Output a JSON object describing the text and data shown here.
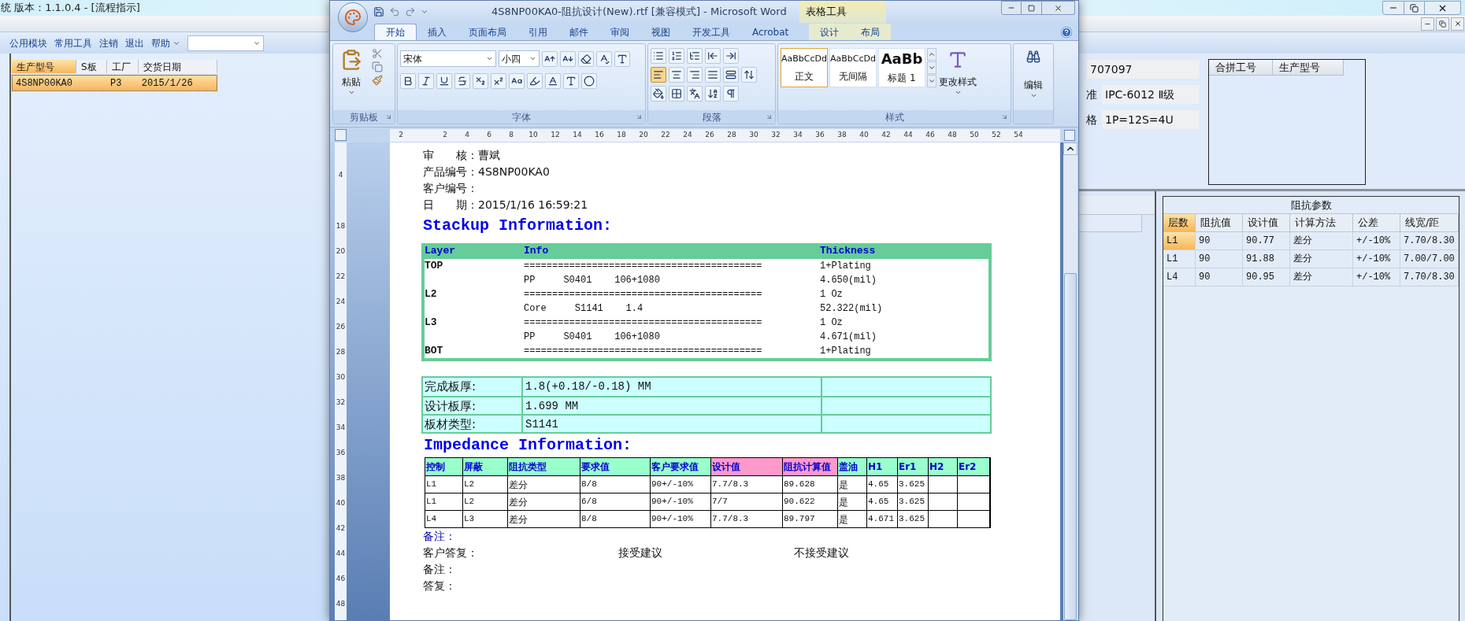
{
  "app": {
    "title": "统 版本：1.1.0.4 - [流程指示]",
    "menu": [
      {
        "label": "公用模块",
        "dropdown": false
      },
      {
        "label": "常用工具",
        "dropdown": false
      },
      {
        "label": "注销",
        "dropdown": false
      },
      {
        "label": "退出",
        "dropdown": false
      },
      {
        "label": "帮助",
        "dropdown": true
      }
    ],
    "grid": {
      "columns": [
        "生产型号",
        "S板",
        "工厂",
        "交货日期"
      ],
      "rows": [
        {
          "cells": [
            "4S8NP00KA0",
            null,
            "P3",
            "2015/1/26"
          ],
          "selected": true
        }
      ]
    },
    "fields": [
      {
        "value": "707097"
      },
      {
        "label": "准",
        "value": "IPC-6012 Ⅱ级"
      },
      {
        "label": "格",
        "value": "1P=12S=4U"
      }
    ],
    "merge_grid": {
      "columns": [
        "合拼工号",
        "生产型号"
      ]
    },
    "impedance": {
      "title": "阻抗参数",
      "columns": [
        "层数",
        "阻抗值",
        "设计值",
        "计算方法",
        "公差",
        "线宽/距"
      ],
      "rows": [
        {
          "cells": [
            "L1",
            "90",
            "90.77",
            "差分",
            "+/-10%",
            "7.70/8.30"
          ],
          "selected": true
        },
        {
          "cells": [
            "L1",
            "90",
            "91.88",
            "差分",
            "+/-10%",
            "7.00/7.00"
          ],
          "selected": false
        },
        {
          "cells": [
            "L4",
            "90",
            "90.95",
            "差分",
            "+/-10%",
            "7.70/8.30"
          ],
          "selected": false
        }
      ]
    }
  },
  "word": {
    "title": "4S8NP00KA0-阻抗设计(New).rtf [兼容模式] - Microsoft Word",
    "contextual_title": "表格工具",
    "tabs": [
      {
        "label": "开始",
        "selected": true,
        "kind": "normal"
      },
      {
        "label": "插入",
        "selected": false,
        "kind": "normal"
      },
      {
        "label": "页面布局",
        "selected": false,
        "kind": "normal"
      },
      {
        "label": "引用",
        "selected": false,
        "kind": "normal"
      },
      {
        "label": "邮件",
        "selected": false,
        "kind": "normal"
      },
      {
        "label": "审阅",
        "selected": false,
        "kind": "normal"
      },
      {
        "label": "视图",
        "selected": false,
        "kind": "normal"
      },
      {
        "label": "开发工具",
        "selected": false,
        "kind": "normal"
      },
      {
        "label": "Acrobat",
        "selected": false,
        "kind": "normal"
      },
      {
        "label": "设计",
        "selected": false,
        "kind": "contextual"
      },
      {
        "label": "布局",
        "selected": false,
        "kind": "contextual"
      }
    ],
    "ribbon": {
      "paste_label": "粘贴",
      "font": "宋体",
      "size": "小四",
      "alignment": [
        {
          "kind": "left",
          "selected": true
        },
        {
          "kind": "center",
          "selected": false
        },
        {
          "kind": "right",
          "selected": false
        },
        {
          "kind": "justify",
          "selected": false
        },
        {
          "kind": "distributed",
          "selected": false
        }
      ],
      "styles": [
        {
          "preview": "AaBbCcDd",
          "name": "正文",
          "selected": true,
          "kind": "body"
        },
        {
          "preview": "AaBbCcDd",
          "name": "无间隔",
          "selected": false,
          "kind": "body"
        },
        {
          "preview": "AaBb",
          "name": "标题 1",
          "selected": false,
          "kind": "heading"
        }
      ],
      "change_styles_label": "更改样式",
      "edit_label": "编辑",
      "groups": [
        "剪贴板",
        "字体",
        "段落",
        "样式"
      ]
    },
    "ruler": {
      "horizontal": [
        "2",
        "2",
        "4",
        "6",
        "8",
        "10",
        "12",
        "14",
        "16",
        "18",
        "20",
        "22",
        "24",
        "26",
        "28",
        "30",
        "32",
        "34",
        "36",
        "38",
        "40",
        "42",
        "44",
        "46",
        "48",
        "50",
        "52",
        "54"
      ],
      "vertical": [
        "4",
        "18",
        "20",
        "22",
        "24",
        "26",
        "28",
        "30",
        "32",
        "34",
        "36",
        "38",
        "40",
        "42",
        "44",
        "46",
        "48"
      ]
    },
    "document": {
      "meta": [
        "审　　核：曹斌",
        "产品编号：4S8NP00KA0",
        "客户编号：",
        "日　　期：2015/1/16 16:59:21"
      ],
      "stackup_title": "Stackup Information:",
      "stackup": {
        "columns": [
          "Layer",
          "Info",
          "Thickness"
        ],
        "rows": [
          {
            "layer": "TOP",
            "info": "==========================================",
            "thickness": "1+Plating"
          },
          {
            "info": "PP     S0401    106+1080",
            "thickness": "4.650(mil)"
          },
          {
            "layer": "L2",
            "info": "==========================================",
            "thickness": "1 Oz"
          },
          {
            "info": "Core     S1141    1.4",
            "thickness": "52.322(mil)"
          },
          {
            "layer": "L3",
            "info": "==========================================",
            "thickness": "1 Oz"
          },
          {
            "info": "PP     S0401    106+1080",
            "thickness": "4.671(mil)"
          },
          {
            "layer": "BOT",
            "info": "==========================================",
            "thickness": "1+Plating"
          }
        ]
      },
      "board": [
        {
          "label": "完成板厚:",
          "value": "1.8(+0.18/-0.18) MM"
        },
        {
          "label": "设计板厚:",
          "value": "1.699 MM"
        },
        {
          "label": "板材类型:",
          "value": "S1141"
        }
      ],
      "impedance_title": "Impedance Information:",
      "impedance": {
        "columns": [
          {
            "label": "控制",
            "color": "#99ffcc"
          },
          {
            "label": "屏蔽",
            "color": "#99ffcc"
          },
          {
            "label": "阻抗类型",
            "color": "#99ffcc"
          },
          {
            "label": "要求值",
            "color": "#99ffcc"
          },
          {
            "label": "客户要求值",
            "color": "#99ffcc"
          },
          {
            "label": "设计值",
            "color": "#ff99cc"
          },
          {
            "label": "阻抗计算值",
            "color": "#ff99cc"
          },
          {
            "label": "盖油",
            "color": "#99ffcc"
          },
          {
            "label": "H1",
            "color": "#99ffcc"
          },
          {
            "label": "Er1",
            "color": "#99ffcc"
          },
          {
            "label": "H2",
            "color": "#99ffcc"
          },
          {
            "label": "Er2",
            "color": "#99ffcc"
          }
        ],
        "rows": [
          [
            "L1",
            "L2",
            "差分",
            "8/8",
            "90+/-10%",
            "7.7/8.3",
            "89.628",
            "是",
            "4.65",
            "3.625"
          ],
          [
            "L1",
            "L2",
            "差分",
            "6/8",
            "90+/-10%",
            "7/7",
            "90.622",
            "是",
            "4.65",
            "3.625"
          ],
          [
            "L4",
            "L3",
            "差分",
            "8/8",
            "90+/-10%",
            "7.7/8.3",
            "89.797",
            "是",
            "4.671",
            "3.625"
          ]
        ]
      },
      "remark": "备注：",
      "reply": {
        "label": "客户答复：",
        "options": [
          "接受建议",
          "不接受建议"
        ]
      },
      "lines": [
        "备注：",
        "答复："
      ]
    }
  }
}
